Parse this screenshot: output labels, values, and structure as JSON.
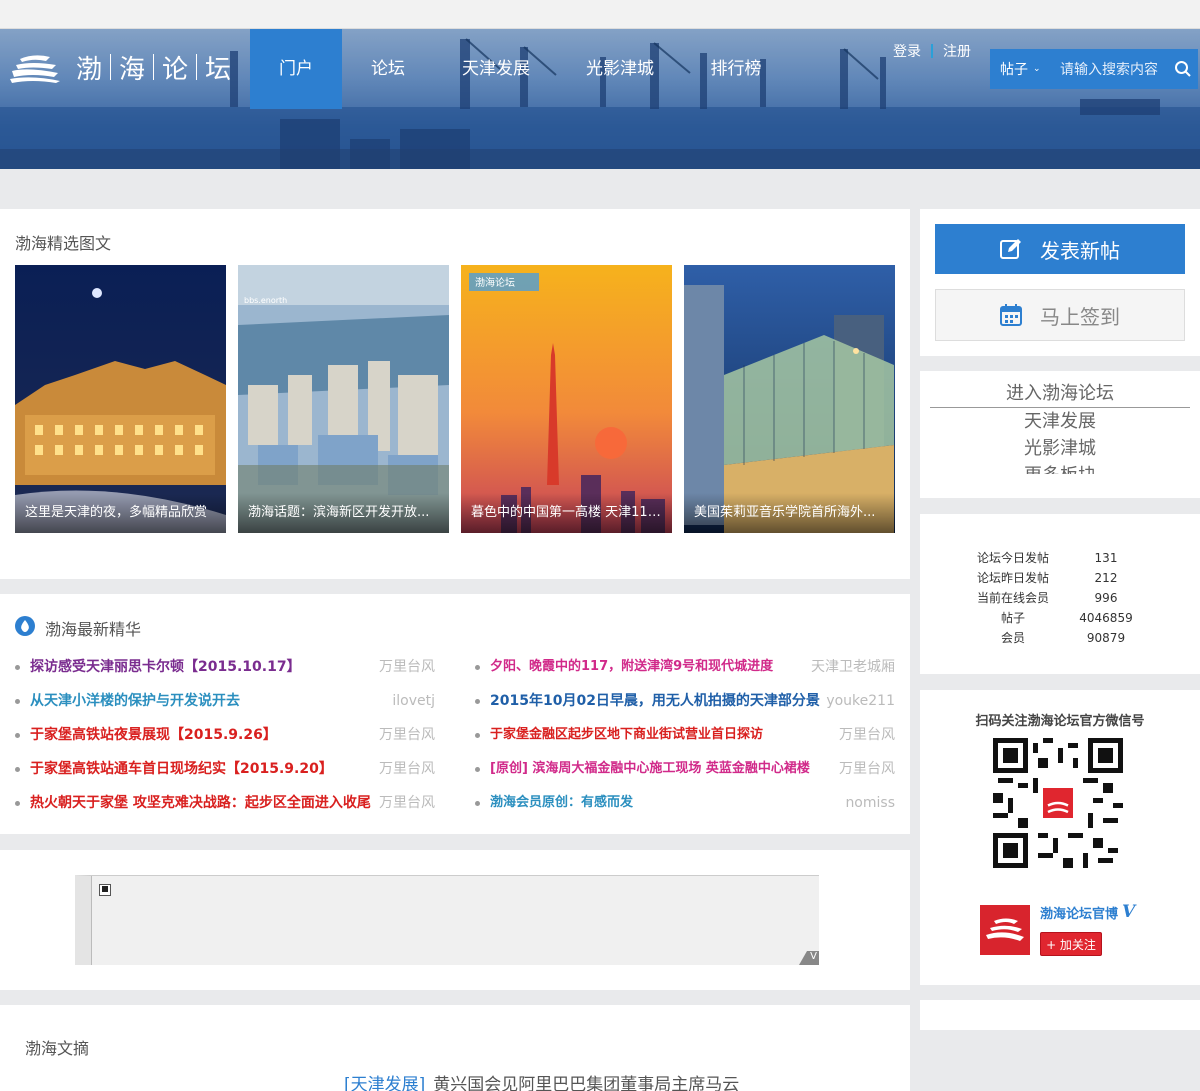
{
  "header": {
    "logo_chars": [
      "渤",
      "海",
      "论",
      "坛"
    ],
    "nav": [
      "门户",
      "论坛",
      "天津发展",
      "光影津城",
      "排行榜"
    ],
    "login": "登录",
    "register": "注册",
    "search_scope": "帖子",
    "search_placeholder": "请输入搜索内容"
  },
  "featured": {
    "title": "渤海精选图文",
    "items": [
      {
        "caption": "这里是天津的夜，多幅精品欣赏"
      },
      {
        "caption": "渤海话题：滨海新区开发开放..."
      },
      {
        "caption": "暮色中的中国第一高楼 天津117..."
      },
      {
        "caption": "美国茱莉亚音乐学院首所海外..."
      }
    ],
    "image_overlay_text": "渤海论坛"
  },
  "latest": {
    "title": "渤海最新精华",
    "left": [
      {
        "title": "探访感受天津丽思卡尔顿【2015.10.17】",
        "author": "万里台风",
        "color": "#7a2c8f"
      },
      {
        "title": "从天津小洋楼的保护与开发说开去",
        "author": "ilovetj",
        "color": "#2b8fbf"
      },
      {
        "title": "于家堡高铁站夜景展现【2015.9.26】",
        "author": "万里台风",
        "color": "#d9201f"
      },
      {
        "title": "于家堡高铁站通车首日现场纪实【2015.9.20】",
        "author": "万里台风",
        "color": "#d9201f"
      },
      {
        "title": "热火朝天于家堡 攻坚克难决战路：起步区全面进入收尾",
        "author": "万里台风",
        "color": "#d9201f"
      }
    ],
    "right": [
      {
        "title": "夕阳、晚霞中的117，附送津湾9号和现代城进度",
        "author": "天津卫老城厢",
        "color": "#d12a8a"
      },
      {
        "title": "2015年10月02日早晨，用无人机拍摄的天津部分景",
        "author": "youke211",
        "color": "#1f5fa8"
      },
      {
        "title": "于家堡金融区起步区地下商业街试营业首日探访",
        "author": "万里台风",
        "color": "#d9201f"
      },
      {
        "title": "[原创] 滨海周大福金融中心施工现场 英蓝金融中心裙楼",
        "author": "万里台风",
        "color": "#d12a8a"
      },
      {
        "title": "渤海会员原创：有感而发",
        "author": "nomiss",
        "color": "#2b8fbf"
      }
    ]
  },
  "sidebar": {
    "post_button": "发表新帖",
    "sign_button": "马上签到",
    "links": {
      "main": "进入渤海论坛",
      "sub": [
        "天津发展",
        "光影津城",
        "更多板块"
      ]
    },
    "stats": [
      {
        "label": "论坛今日发帖",
        "value": "131"
      },
      {
        "label": "论坛昨日发帖",
        "value": "212"
      },
      {
        "label": "当前在线会员",
        "value": "996"
      },
      {
        "label": "帖子",
        "value": "4046859"
      },
      {
        "label": "会员",
        "value": "90879"
      }
    ],
    "wechat_title": "扫码关注渤海论坛官方微信号",
    "weibo_name": "渤海论坛官博",
    "weibo_v": "V",
    "follow_label": "+ 加关注"
  },
  "ad": {
    "corner_label": "V"
  },
  "digest": {
    "title": "渤海文摘",
    "item_category": "[天津发展]",
    "item_title": "黄兴国会见阿里巴巴集团董事局主席马云"
  },
  "colors": {
    "brand_blue": "#2d7fd0",
    "accent_red": "#d9201f",
    "purple": "#7a2c8f",
    "magenta": "#d12a8a"
  }
}
